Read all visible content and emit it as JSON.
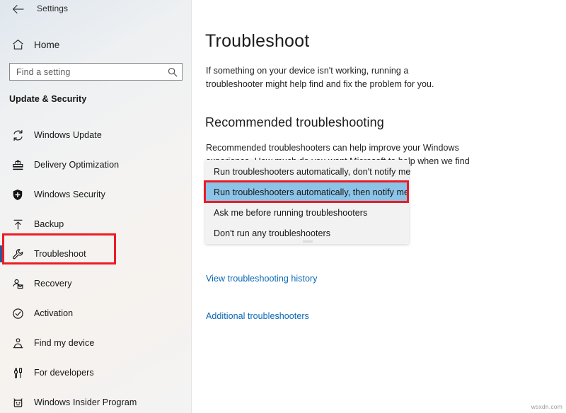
{
  "window": {
    "app_title": "Settings",
    "back_icon": "back-arrow-icon"
  },
  "top_strip": {
    "scrollbar_icon": "horizontal-scrollbar"
  },
  "sidebar": {
    "home": {
      "label": "Home",
      "icon": "home-icon"
    },
    "search": {
      "placeholder": "Find a setting",
      "value": "",
      "icon": "search-icon"
    },
    "section_title": "Update & Security",
    "items": [
      {
        "label": "Windows Update",
        "icon": "sync-icon",
        "selected": false
      },
      {
        "label": "Delivery Optimization",
        "icon": "delivery-icon",
        "selected": false
      },
      {
        "label": "Windows Security",
        "icon": "shield-icon",
        "selected": false
      },
      {
        "label": "Backup",
        "icon": "upload-arrow-icon",
        "selected": false
      },
      {
        "label": "Troubleshoot",
        "icon": "wrench-icon",
        "selected": true
      },
      {
        "label": "Recovery",
        "icon": "recovery-icon",
        "selected": false
      },
      {
        "label": "Activation",
        "icon": "check-circle-icon",
        "selected": false
      },
      {
        "label": "Find my device",
        "icon": "locate-person-icon",
        "selected": false
      },
      {
        "label": "For developers",
        "icon": "tools-icon",
        "selected": false
      },
      {
        "label": "Windows Insider Program",
        "icon": "insider-icon",
        "selected": false
      }
    ]
  },
  "main": {
    "page_title": "Troubleshoot",
    "intro": "If something on your device isn't working, running a troubleshooter might help find and fix the problem for you.",
    "subhead": "Recommended troubleshooting",
    "body_text": "Recommended troubleshooters can help improve your Windows experience. How much do you want Microsoft to help when we find problems you might not be able to fix?",
    "links": [
      {
        "label": "View troubleshooting history"
      },
      {
        "label": "Additional troubleshooters"
      }
    ]
  },
  "dropdown": {
    "options": [
      {
        "label": "Run troubleshooters automatically, don't notify me",
        "highlighted": false
      },
      {
        "label": "Run troubleshooters automatically, then notify me",
        "highlighted": true
      },
      {
        "label": "Ask me before running troubleshooters",
        "highlighted": false
      },
      {
        "label": "Don't run any troubleshooters",
        "highlighted": false
      }
    ]
  },
  "annotations": {
    "highlight_color": "#ec1c24",
    "selection_color": "#8cc4e8",
    "accent_color": "#2b5797",
    "link_color": "#0a67b5"
  },
  "watermark": "wsxdn.com"
}
